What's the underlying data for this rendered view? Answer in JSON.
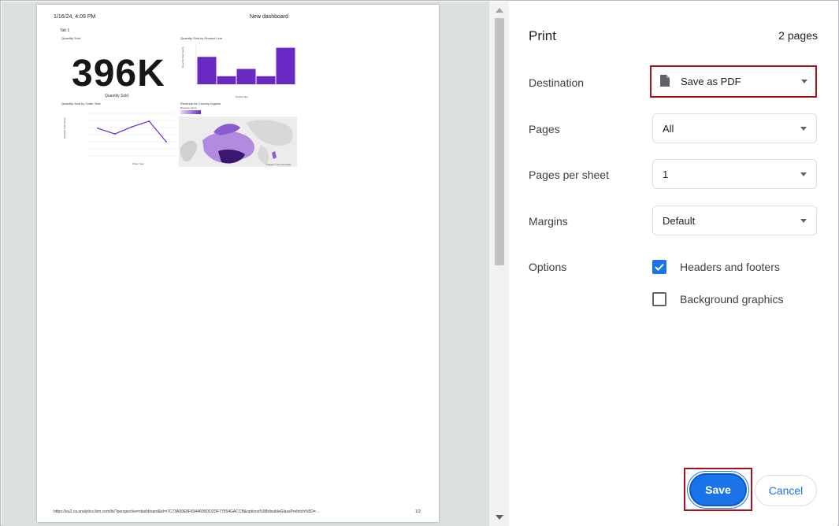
{
  "preview": {
    "header_left": "1/16/24, 4:09 PM",
    "header_center": "New dashboard",
    "tab_label": "Tab 1",
    "kpi_tile_title": "Quantity Sold",
    "kpi_value": "396K",
    "kpi_caption": "Quantity Sold",
    "bar_tile_title": "Quantity Sold by Product Line",
    "bar_xlabel": "Product line",
    "bar_ylabel": "Quantity Sold (sum)",
    "line_tile_title": "Quantity Sold by Order Year",
    "line_xlabel": "Order Year",
    "line_ylabel": "Quantity Sold (sum)",
    "map_tile_title": "Revenue for Country regions",
    "map_legend_label": "Revenue (sum)",
    "map_attribution": "© Mapbox © OpenStreetMap",
    "footer_url": "https://eu2.ca.analytics.ibm.com/bi/?perspective=dashboard&id=i7C73A99E8F8344609DD2DF77554GACCB&options%5BdisableGlassPrefetch%5D=...",
    "footer_page": "1/2"
  },
  "chart_data": [
    {
      "type": "bar",
      "title": "Quantity Sold by Product Line",
      "xlabel": "Product line",
      "ylabel": "Quantity Sold (sum)",
      "categories": [
        "",
        "",
        "",
        "",
        ""
      ],
      "values": [
        75,
        22,
        42,
        22,
        100
      ],
      "ylim": [
        0,
        110
      ]
    },
    {
      "type": "line",
      "title": "Quantity Sold by Order Year",
      "xlabel": "Order Year",
      "ylabel": "Quantity Sold (sum)",
      "x": [
        0,
        1,
        2,
        3,
        4
      ],
      "values": [
        78,
        62,
        82,
        98,
        40
      ],
      "ylim": [
        0,
        120
      ]
    }
  ],
  "panel": {
    "title": "Print",
    "page_count": "2 pages",
    "destination_label": "Destination",
    "destination_value": "Save as PDF",
    "pages_label": "Pages",
    "pages_value": "All",
    "pps_label": "Pages per sheet",
    "pps_value": "1",
    "margins_label": "Margins",
    "margins_value": "Default",
    "options_label": "Options",
    "opt_headers": "Headers and footers",
    "opt_background": "Background graphics",
    "save": "Save",
    "cancel": "Cancel"
  },
  "colors": {
    "accent": "#1a73e8",
    "highlight": "#a8121a",
    "chart_purple": "#6929c4"
  },
  "icons": {
    "file": "file-icon",
    "check": "checkmark-icon",
    "caret": "chevron-down-icon"
  }
}
